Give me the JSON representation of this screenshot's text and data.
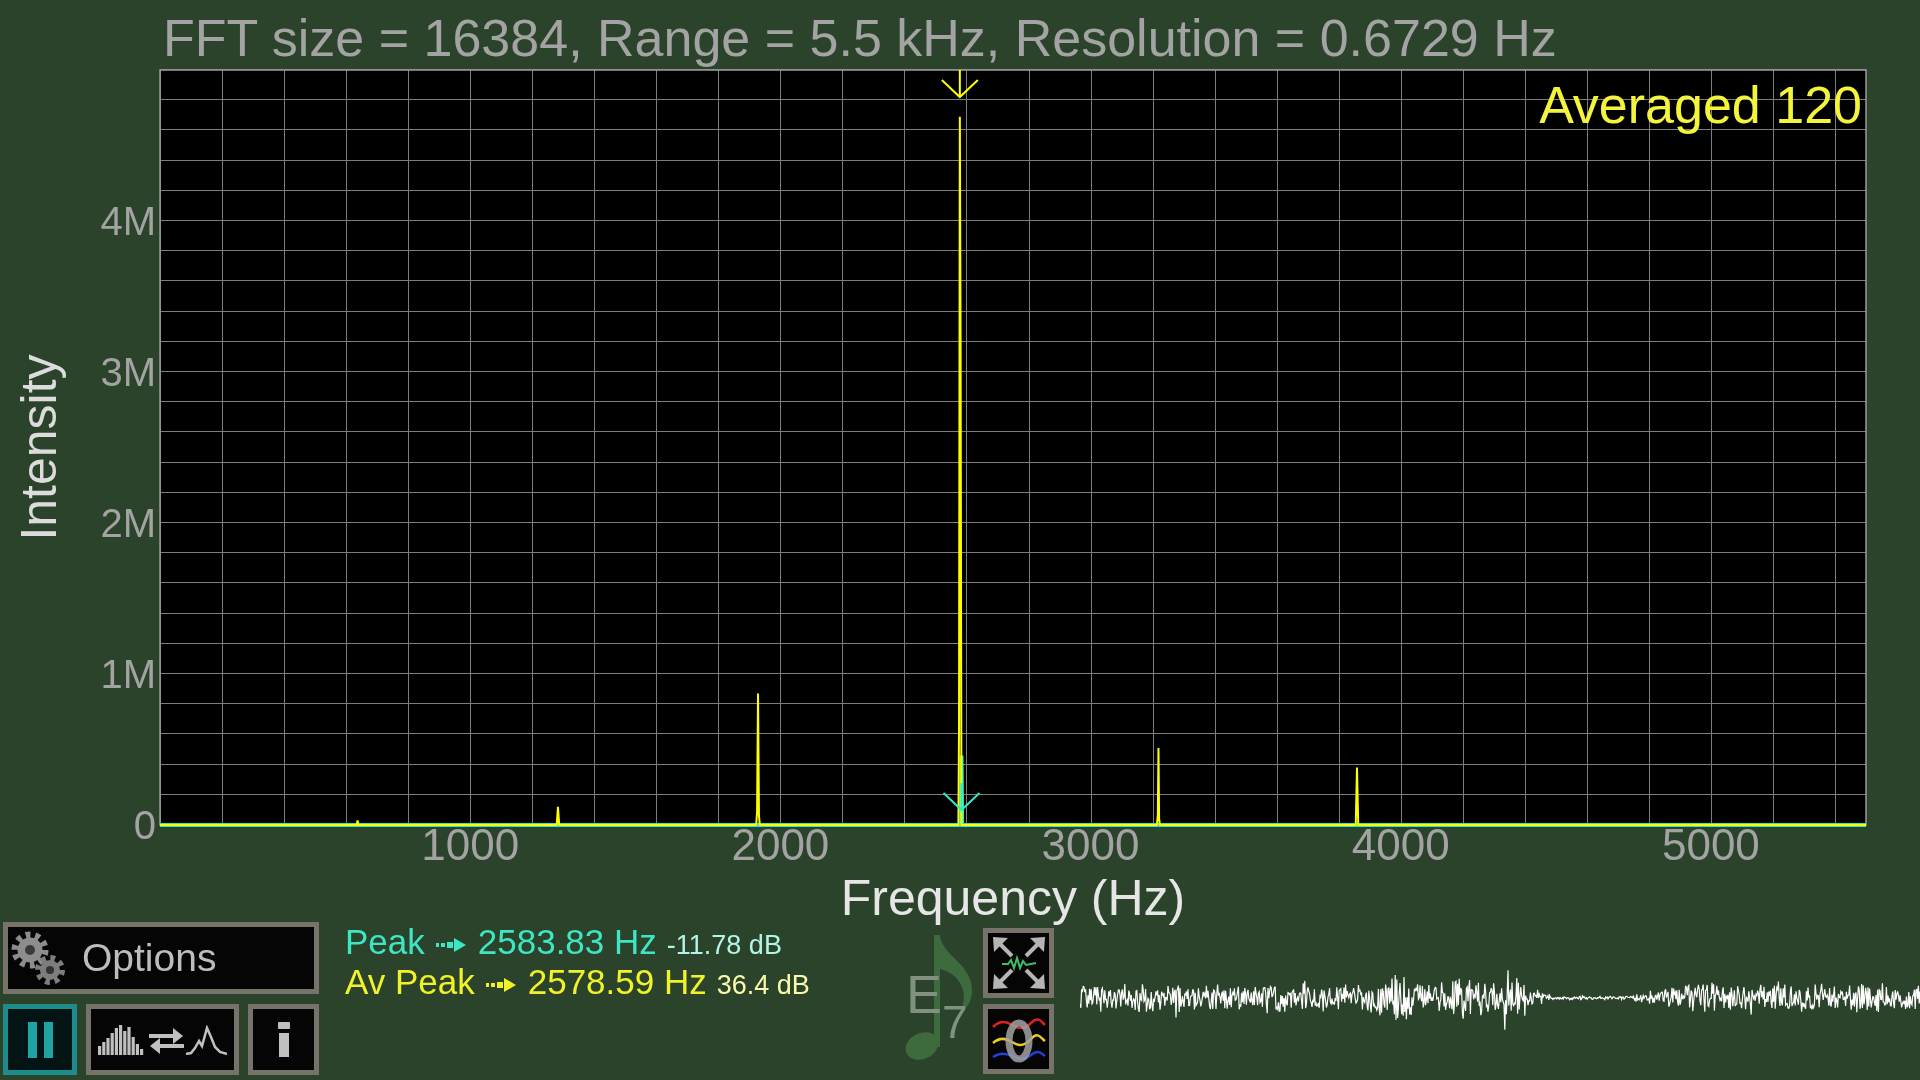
{
  "spectrum": {
    "chart_data": {
      "type": "line",
      "title": "FFT size = 16384, Range = 5.5 kHz, Resolution = 0.6729 Hz",
      "xlabel": "Frequency (Hz)",
      "ylabel": "Intensity",
      "x": [
        0,
        634,
        637,
        640,
        1279,
        1283,
        1287,
        1922,
        1925,
        1928,
        1931,
        1934,
        2574,
        2576,
        2578.6,
        2581,
        2583,
        2584,
        2586,
        3214,
        3217,
        3219,
        3221,
        3224,
        3855,
        3859,
        3863,
        5500
      ],
      "series": [
        {
          "color": "#ffff00",
          "values": [
            0,
            0,
            30000,
            0,
            0,
            120000,
            0,
            0,
            90000,
            870000,
            60000,
            0,
            0,
            650000,
            4690000,
            3250000,
            880000,
            0,
            0,
            0,
            70000,
            510000,
            40000,
            0,
            0,
            380000,
            0,
            0
          ]
        },
        {
          "color": "#2ee8c8",
          "values": [
            0,
            0,
            0,
            0,
            0,
            0,
            0,
            0,
            0,
            0,
            0,
            0,
            0,
            0,
            0,
            0,
            0,
            460000,
            0,
            0,
            0,
            0,
            0,
            0,
            0,
            0,
            0,
            0
          ]
        }
      ],
      "xlim": [
        0,
        5500
      ],
      "ylim": [
        0,
        5000000
      ],
      "xticks": [
        1000,
        2000,
        3000,
        4000,
        5000
      ],
      "yticks": [
        {
          "value": 0,
          "label": "0"
        },
        {
          "value": 1000000,
          "label": "1M"
        },
        {
          "value": 2000000,
          "label": "2M"
        },
        {
          "value": 3000000,
          "label": "3M"
        },
        {
          "value": 4000000,
          "label": "4M"
        }
      ],
      "grid": true
    },
    "average_label": "Averaged 120"
  },
  "controls": {
    "options_button": {
      "label": "Options"
    },
    "buttons": [
      {
        "kind": "pause",
        "active": true
      },
      {
        "kind": "view-toggle",
        "active": false
      },
      {
        "kind": "info",
        "active": false
      }
    ]
  },
  "readouts": [
    {
      "label": "Peak",
      "color": "#3ee6c4",
      "frequency": "2583.83 Hz",
      "db": "-11.78 dB"
    },
    {
      "label": "Av Peak",
      "color": "#f2f22a",
      "frequency": "2578.59 Hz",
      "db": "36.4 dB"
    }
  ],
  "note": {
    "label": "E$_{7}$"
  },
  "tools": [
    {
      "kind": "expand"
    },
    {
      "kind": "waves"
    }
  ]
}
